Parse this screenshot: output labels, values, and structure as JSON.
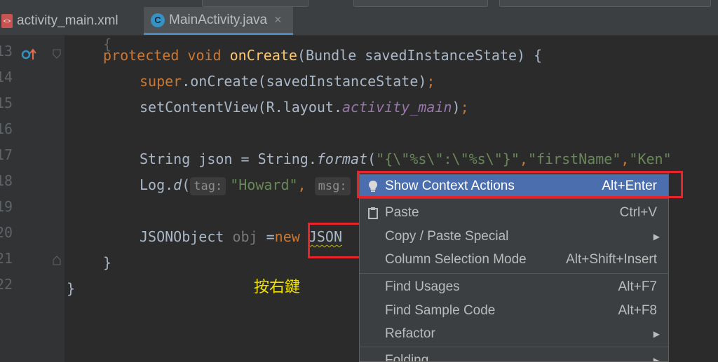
{
  "tabs": [
    {
      "label": "activity_main.xml",
      "icon": "xml-file-icon",
      "close": "×"
    },
    {
      "label": "MainActivity.java",
      "icon": "java-class-icon",
      "close": "×",
      "active": true
    }
  ],
  "gutter": {
    "line_numbers": [
      "13",
      "14",
      "15",
      "16",
      "17",
      "18",
      "19",
      "20",
      "21",
      "22"
    ]
  },
  "code": {
    "l13": {
      "kw1": "protected",
      "kw2": "void",
      "fn": "onCreate",
      "rest": "(Bundle savedInstanceState) {"
    },
    "l14": {
      "kw": "super",
      "rest": ".onCreate(savedInstanceState)",
      "semi": ";"
    },
    "l15": {
      "a": "setContentView(R.layout.",
      "field": "activity_main",
      "b": ")",
      "semi": ";"
    },
    "l17": {
      "a": "String json = String.",
      "ital": "format",
      "b": "(",
      "s1": "\"{\\\"%s\\\":\\\"%s\\\"}\"",
      "c1": ",",
      "s2": "\"firstName\"",
      "c2": ",",
      "s3": "\"Ken\""
    },
    "l18": {
      "a": "Log.",
      "ital": "d",
      "b": "(",
      "hint1": "tag:",
      "s1": "\"Howard\"",
      "c1": ",",
      "hint2": "msg:"
    },
    "l20": {
      "a": "JSONObject ",
      "obj": "obj",
      "b": " =",
      "kw": "new",
      "c": " ",
      "cls": "JSON"
    },
    "l21": {
      "text": "}"
    },
    "l22": {
      "text": "}"
    }
  },
  "annotation": "按右鍵",
  "context_menu": {
    "items": [
      {
        "label": "Show Context Actions",
        "shortcut": "Alt+Enter",
        "icon": "lightbulb-icon"
      },
      {
        "label": "Paste",
        "shortcut": "Ctrl+V",
        "icon": "clipboard-icon"
      },
      {
        "label": "Copy / Paste Special",
        "shortcut": "",
        "submenu": true
      },
      {
        "label": "Column Selection Mode",
        "shortcut": "Alt+Shift+Insert"
      },
      {
        "label": "Find Usages",
        "shortcut": "Alt+F7"
      },
      {
        "label": "Find Sample Code",
        "shortcut": "Alt+F8"
      },
      {
        "label": "Refactor",
        "shortcut": "",
        "submenu": true
      },
      {
        "label": "Folding",
        "shortcut": "",
        "submenu": true
      }
    ],
    "submenu_arrow": "▶"
  },
  "colors": {
    "editor_bg": "#2b2b2b",
    "keyword": "#cc7832",
    "method": "#ffc66d",
    "string": "#6a8759",
    "field": "#9876aa",
    "menu_selected": "#4b6eaf",
    "highlight_box": "#e8232c",
    "annotation": "#f0e000"
  }
}
